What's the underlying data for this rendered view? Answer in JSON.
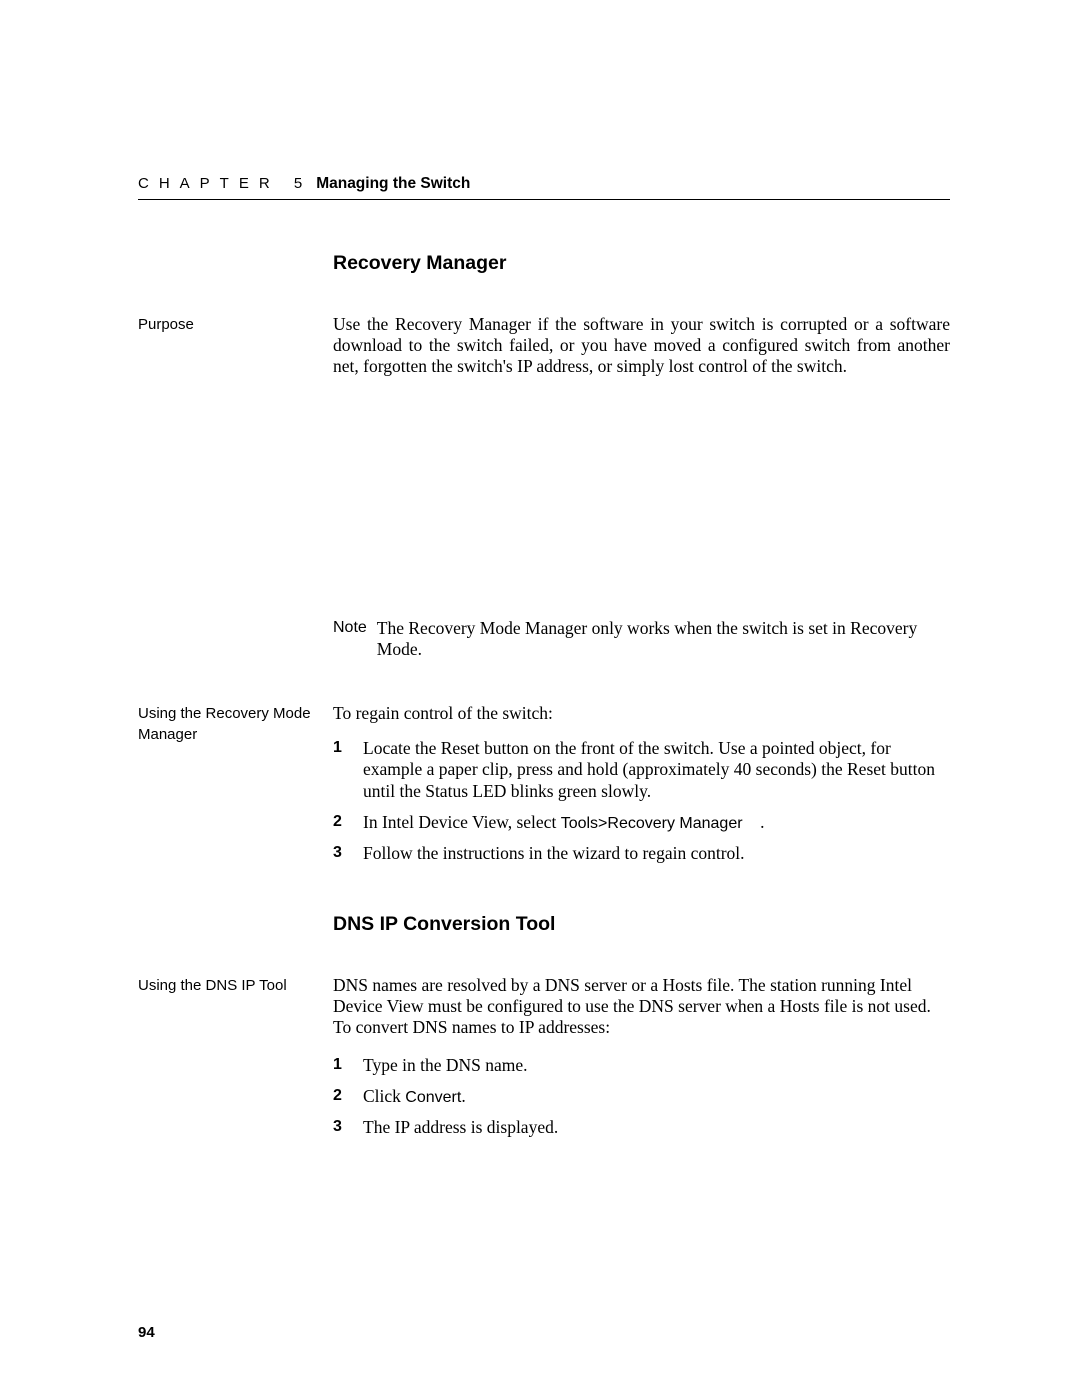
{
  "header": {
    "chapter_label": "CHAPTER 5",
    "chapter_title": "Managing the Switch"
  },
  "section_recovery": {
    "heading": "Recovery Manager",
    "purpose_label": "Purpose",
    "purpose_text": "Use the Recovery Manager if the software in your switch is corrupted or a software download to the switch failed, or you have moved a configured switch from another net, forgotten the switch's IP address, or simply lost control of the switch.",
    "note_label": "Note",
    "note_text": "The Recovery Mode Manager only works when the switch is set in Recovery Mode.",
    "using_label": "Using the Recovery Mode Manager",
    "intro": "To regain control of the switch:",
    "steps": {
      "s1": "Locate the Reset button on the front of the switch. Use a pointed object, for example a paper clip, press and hold (approximately 40 seconds) the Reset button until the Status LED blinks green slowly.",
      "s2_a": "In Intel Device View, select ",
      "s2_b": "Tools>Recovery Manager",
      "s2_c": ".",
      "s3": "Follow the instructions in the wizard to regain control."
    }
  },
  "section_dns": {
    "heading": "DNS IP Conversion Tool",
    "using_label": "Using the DNS IP Tool",
    "intro": "DNS names are resolved by a DNS server or a Hosts file. The station running Intel Device View must be configured to use the DNS server when a Hosts file is not used. To convert DNS names to IP addresses:",
    "steps": {
      "s1": "Type in the DNS name.",
      "s2_a": "Click ",
      "s2_b": "Convert",
      "s2_c": ".",
      "s3": "The IP address is displayed."
    }
  },
  "page_number": "94"
}
